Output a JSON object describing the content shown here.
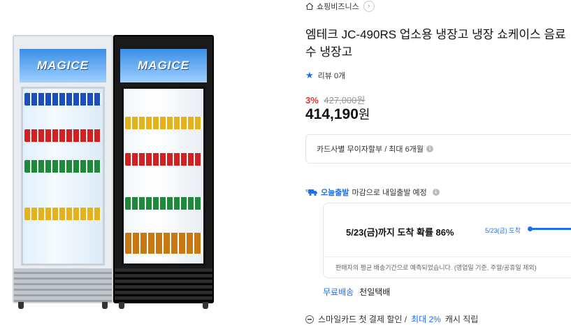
{
  "product_image": {
    "brand_sign": "MAGICE"
  },
  "store": {
    "name": "쇼핑비즈니스",
    "chevron": "›"
  },
  "product": {
    "title": "엠테크 JC-490RS 업소용 냉장고 냉장 쇼케이스 음료수 냉장고",
    "review_label": "리뷰 0개",
    "discount_pct": "3%",
    "original_price": "427,000원",
    "price_number": "414,190",
    "price_unit": "원"
  },
  "installment": {
    "text": "카드사별 무이자할부 / 최대 6개월",
    "info": "i"
  },
  "delivery": {
    "badge": "오늘출발",
    "text": "마감으로 내일출발 예정",
    "eta_main": "5/23(금)까지 도착 확률 86%",
    "eta_side": "5/23(금) 도착",
    "eta_note": "판매자의 평균 배송기간으로 예측되었습니다. (영업일 기준, 주말/공휴일 제외)",
    "eta_probability": 0.86,
    "free_shipping": "무료배송",
    "carrier": "천일택배"
  },
  "promo": {
    "prefix": "스마일카드 첫 결제 할인 /",
    "highlight": "최대 2%",
    "suffix": "캐시 직립"
  },
  "colors": {
    "accent": "#1e6ef0",
    "discount": "#e8312f"
  }
}
